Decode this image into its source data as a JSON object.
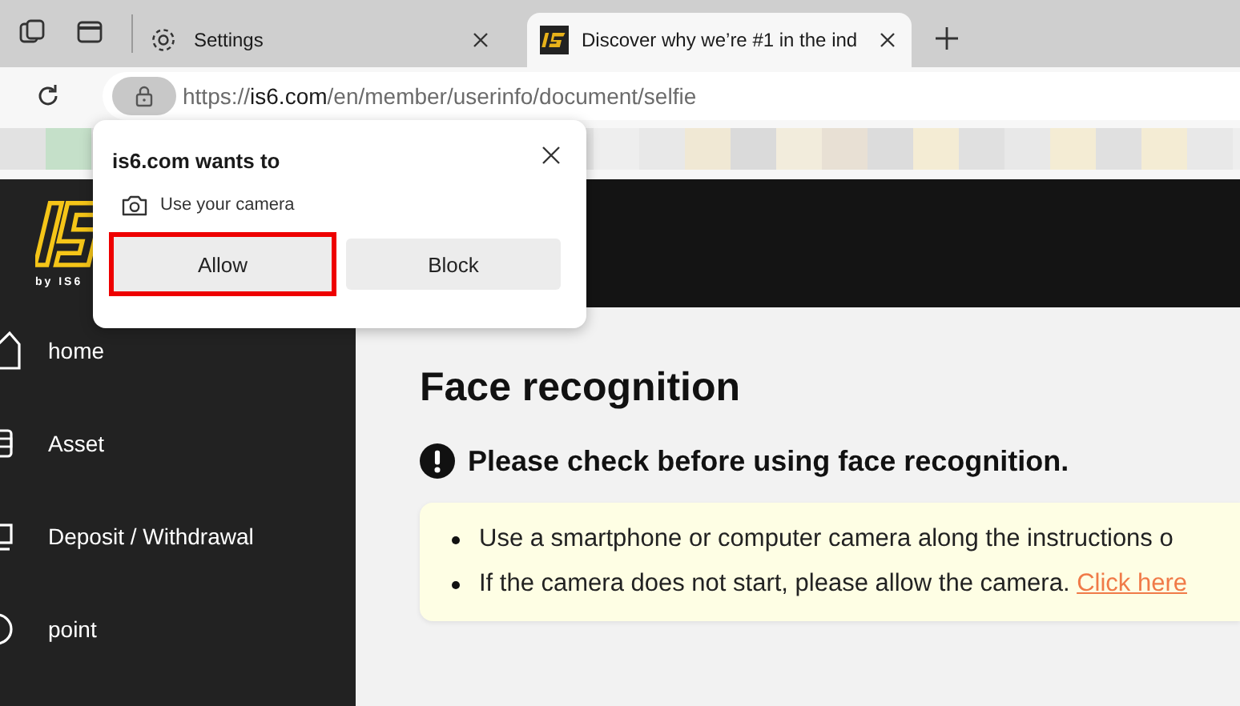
{
  "browser": {
    "tabs": [
      {
        "title": "Settings",
        "kind": "settings",
        "selected": false
      },
      {
        "title": "Discover why we’re #1 in the ind",
        "kind": "site",
        "selected": true
      }
    ],
    "address": {
      "scheme": "https://",
      "domain": "is6.com",
      "path": "/en/member/userinfo/document/selfie"
    }
  },
  "permission_popup": {
    "title": "is6.com wants to",
    "permission": "Use your camera",
    "buttons": [
      {
        "label": "Allow",
        "highlighted": true
      },
      {
        "label": "Block",
        "highlighted": false
      }
    ]
  },
  "sidebar": {
    "logo_tagline": "by IS6",
    "items": [
      {
        "label": "home",
        "kind": "home"
      },
      {
        "label": "Asset",
        "kind": "wallet"
      },
      {
        "label": "Deposit / Withdrawal",
        "kind": "monitor"
      },
      {
        "label": "point",
        "kind": "coin"
      }
    ]
  },
  "main": {
    "title": "Face recognition",
    "notice": "Please check before using face recognition.",
    "instructions": [
      {
        "text": "Use a smartphone or computer camera along the instructions o"
      },
      {
        "text": "If the camera does not start, please allow the camera.",
        "link": "Click here"
      }
    ]
  }
}
